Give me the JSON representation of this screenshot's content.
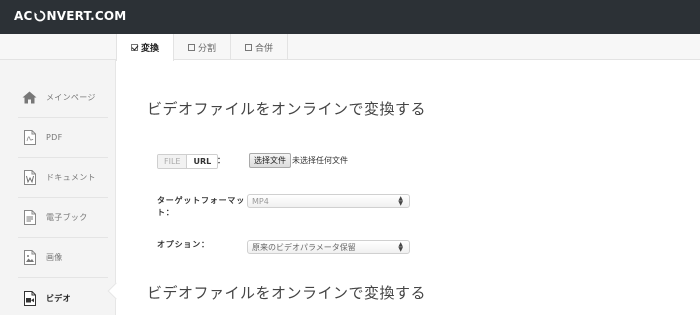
{
  "header": {
    "logo_left": "AC",
    "logo_right": "NVERT.COM",
    "logo_icon": "refresh-o-icon"
  },
  "tabs": [
    {
      "label": "変換",
      "checked": true
    },
    {
      "label": "分割",
      "checked": false
    },
    {
      "label": "合併",
      "checked": false
    }
  ],
  "sidebar": {
    "items": [
      {
        "label": "メインページ",
        "icon": "home-icon"
      },
      {
        "label": "PDF",
        "icon": "pdf-file-icon"
      },
      {
        "label": "ドキュメント",
        "icon": "word-file-icon"
      },
      {
        "label": "電子ブック",
        "icon": "ebook-file-icon"
      },
      {
        "label": "画像",
        "icon": "image-file-icon"
      },
      {
        "label": "ビデオ",
        "icon": "video-file-icon",
        "active": true
      }
    ]
  },
  "main": {
    "title": "ビデオファイルをオンラインで変換する",
    "title_repeat": "ビデオファイルをオンラインで変換する",
    "source": {
      "file_label": "FILE",
      "url_label": "URL",
      "colon": "：",
      "choose_button": "选择文件",
      "no_file_text": "未选择任何文件"
    },
    "target_format": {
      "label": "ターゲットフォーマット：",
      "value": "MP4"
    },
    "options": {
      "label": "オプション：",
      "value": "原来のビデオパラメータ保留"
    }
  },
  "colors": {
    "topbar": "#2c3136",
    "sidebar_bg": "#f4f4f4",
    "tabstrip_bg": "#f7f7f7"
  }
}
